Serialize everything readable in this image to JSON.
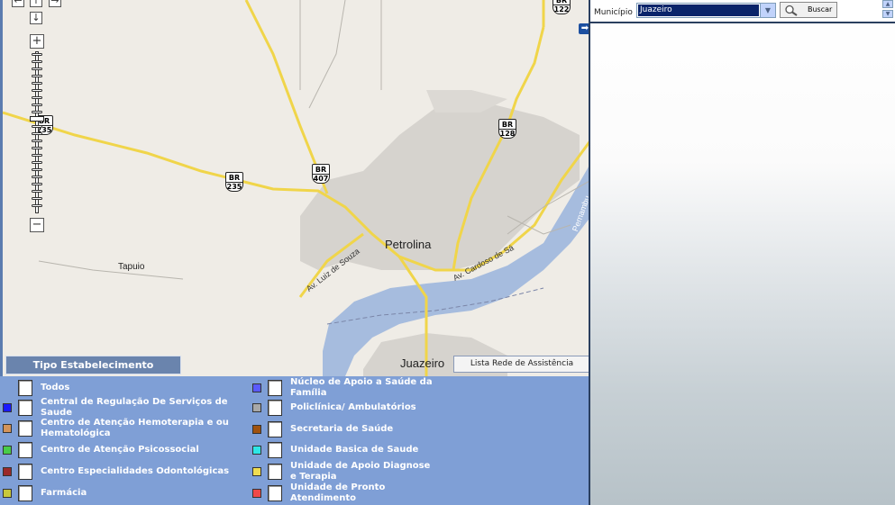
{
  "map": {
    "places": {
      "petrolina": "Petrolina",
      "juazeiro": "Juazeiro",
      "tapuio": "Tapuio"
    },
    "streets": {
      "luiz_souza": "Av. Luiz de Souza",
      "cardoso_sa": "Av. Cardoso de Sá",
      "pernambuco": "Pernambu"
    },
    "shields": [
      {
        "top": "BR",
        "num": "122"
      },
      {
        "top": "BR",
        "num": "128"
      },
      {
        "top": "BR",
        "num": "407"
      },
      {
        "top": "BR",
        "num": "235"
      },
      {
        "top": "BR",
        "num": "235"
      }
    ],
    "zoom_in": "+",
    "zoom_out": "−",
    "pan_up": "↑",
    "pan_down": "↓",
    "pan_left": "←",
    "pan_right": "→",
    "colors": {
      "land": "#efece6",
      "water": "#a6bcde",
      "road": "#f7e06e",
      "urban": "#cfcfcf"
    }
  },
  "legend": {
    "tab_title": "Tipo Estabelecimento",
    "lista_button": "Lista Rede de Assistência",
    "left_items": [
      {
        "label": "Todos",
        "color": ""
      },
      {
        "label": "Central de Regulação De Serviços de Saude",
        "color": "#1a1aff"
      },
      {
        "label": "Centro de Atenção Hemoterapia e ou Hematológica",
        "color": "#d4945a"
      },
      {
        "label": "Centro de Atenção Psicossocial",
        "color": "#49cc49"
      },
      {
        "label": "Centro Especialidades Odontológicas",
        "color": "#9b2a2a"
      },
      {
        "label": "Farmácia",
        "color": "#c8c83a"
      }
    ],
    "right_items": [
      {
        "label": "Núcleo de Apoio a Saúde da Família",
        "color": "#5a5aff"
      },
      {
        "label": "Policlínica/ Ambulatórios",
        "color": "#a8a8a8"
      },
      {
        "label": "Secretaria de Saúde",
        "color": "#a0520f"
      },
      {
        "label": "Unidade Basica de Saude",
        "color": "#2ee6e6"
      },
      {
        "label": "Unidade de Apoio Diagnose e Terapia",
        "color": "#f0dc50"
      },
      {
        "label": "Unidade de Pronto Atendimento",
        "color": "#f04848"
      }
    ]
  },
  "search": {
    "label": "Município",
    "selected": "Juazeiro",
    "button": "Buscar"
  }
}
